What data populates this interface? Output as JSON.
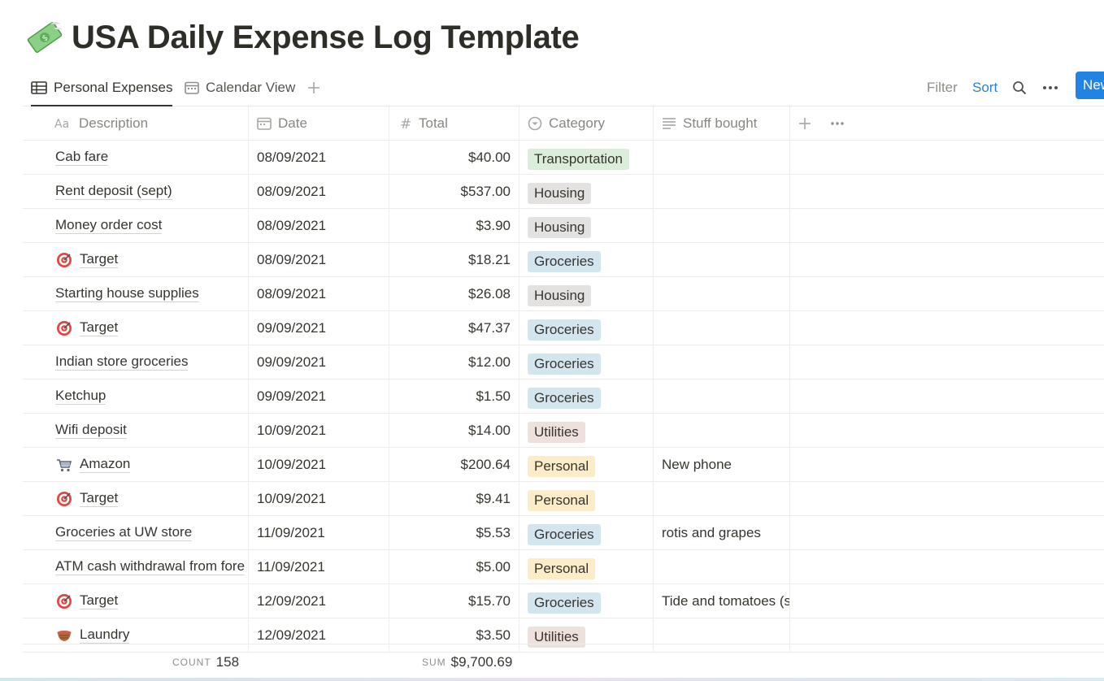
{
  "page": {
    "title": "USA Daily Expense Log Template",
    "icon": "money-with-wings-icon"
  },
  "tabs": [
    {
      "label": "Personal Expenses",
      "icon": "table-icon",
      "active": true
    },
    {
      "label": "Calendar View",
      "icon": "calendar-icon",
      "active": false
    }
  ],
  "toolbar": {
    "filter_label": "Filter",
    "sort_label": "Sort",
    "new_label": "New",
    "accent": "#2383e2"
  },
  "columns": {
    "description": "Description",
    "date": "Date",
    "total": "Total",
    "category": "Category",
    "stuff": "Stuff bought"
  },
  "category_colors": {
    "Transportation": "#dbeddb",
    "Housing": "#e3e2e0",
    "Groceries": "#d3e5ef",
    "Utilities": "#eee0da",
    "Personal": "#fdecc8"
  },
  "rows": [
    {
      "icon": "",
      "description": "Cab fare",
      "date": "08/09/2021",
      "total": "$40.00",
      "category": "Transportation",
      "stuff": ""
    },
    {
      "icon": "",
      "description": "Rent deposit (sept)",
      "date": "08/09/2021",
      "total": "$537.00",
      "category": "Housing",
      "stuff": ""
    },
    {
      "icon": "",
      "description": "Money order cost",
      "date": "08/09/2021",
      "total": "$3.90",
      "category": "Housing",
      "stuff": ""
    },
    {
      "icon": "target-icon",
      "description": "Target",
      "date": "08/09/2021",
      "total": "$18.21",
      "category": "Groceries",
      "stuff": ""
    },
    {
      "icon": "",
      "description": "Starting house supplies",
      "date": "08/09/2021",
      "total": "$26.08",
      "category": "Housing",
      "stuff": ""
    },
    {
      "icon": "target-icon",
      "description": "Target",
      "date": "09/09/2021",
      "total": "$47.37",
      "category": "Groceries",
      "stuff": ""
    },
    {
      "icon": "",
      "description": "Indian store groceries",
      "date": "09/09/2021",
      "total": "$12.00",
      "category": "Groceries",
      "stuff": ""
    },
    {
      "icon": "",
      "description": "Ketchup",
      "date": "09/09/2021",
      "total": "$1.50",
      "category": "Groceries",
      "stuff": ""
    },
    {
      "icon": "",
      "description": "Wifi deposit",
      "date": "10/09/2021",
      "total": "$14.00",
      "category": "Utilities",
      "stuff": ""
    },
    {
      "icon": "cart-icon",
      "description": "Amazon",
      "date": "10/09/2021",
      "total": "$200.64",
      "category": "Personal",
      "stuff": "New phone"
    },
    {
      "icon": "target-icon",
      "description": "Target",
      "date": "10/09/2021",
      "total": "$9.41",
      "category": "Personal",
      "stuff": ""
    },
    {
      "icon": "",
      "description": "Groceries at UW store",
      "date": "11/09/2021",
      "total": "$5.53",
      "category": "Groceries",
      "stuff": "rotis and grapes"
    },
    {
      "icon": "",
      "description": "ATM cash withdrawal from fore",
      "date": "11/09/2021",
      "total": "$5.00",
      "category": "Personal",
      "stuff": ""
    },
    {
      "icon": "target-icon",
      "description": "Target",
      "date": "12/09/2021",
      "total": "$15.70",
      "category": "Groceries",
      "stuff": "Tide and tomatoes (s"
    },
    {
      "icon": "basket-icon",
      "description": "Laundry",
      "date": "12/09/2021",
      "total": "$3.50",
      "category": "Utilities",
      "stuff": ""
    }
  ],
  "footer": {
    "count_label": "COUNT",
    "count_value": "158",
    "sum_label": "SUM",
    "sum_value": "$9,700.69"
  }
}
